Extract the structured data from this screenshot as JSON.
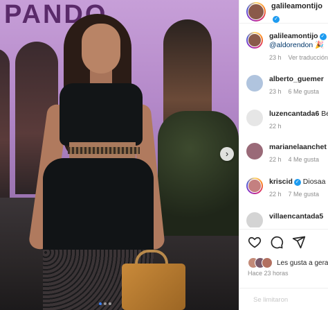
{
  "photo": {
    "sign_text": "PANDO",
    "next_button": "›",
    "carousel": {
      "count": 3,
      "active_index": 0
    }
  },
  "header": {
    "username": "galileamontijo",
    "verified_glyph": "✓"
  },
  "comments": [
    {
      "username": "galileamontijo",
      "verified": true,
      "text": "@aldorendon 🎉",
      "link": "@aldorendon",
      "time": "23 h",
      "likes": "",
      "action": "Ver traducción",
      "avatar_color": "#8a5a4a"
    },
    {
      "username": "alberto_guemer",
      "verified": false,
      "text": "",
      "time": "23 h",
      "likes": "6 Me gusta",
      "action": "",
      "avatar_color": "#b0c4de"
    },
    {
      "username": "luzencantada6",
      "verified": false,
      "text": "Be",
      "time": "22 h",
      "likes": "",
      "action": "",
      "avatar_color": "#d9d9d9"
    },
    {
      "username": "marianelaanchet",
      "verified": false,
      "text": "",
      "time": "22 h",
      "likes": "4 Me gusta",
      "action": "",
      "avatar_color": "#9a6a78"
    },
    {
      "username": "kriscid",
      "verified": false,
      "text": "Diosaa",
      "time": "22 h",
      "likes": "7 Me gusta",
      "action": "",
      "avatar_color": "#c48080"
    },
    {
      "username": "villaencantada5",
      "verified": false,
      "text": "",
      "time": "",
      "likes": "",
      "action": "",
      "avatar_color": "#d4d4d4"
    }
  ],
  "actions": {
    "likes_text": "Les gusta a gera",
    "time_ago": "Hace 23 horas",
    "liker_colors": [
      "#c38a78",
      "#7a5a6a",
      "#b27060"
    ]
  },
  "add_comment": {
    "placeholder": "Se limitaron"
  },
  "colors": {
    "link": "#00376b",
    "muted": "#8e8e8e",
    "verified": "#1d9bf0"
  }
}
